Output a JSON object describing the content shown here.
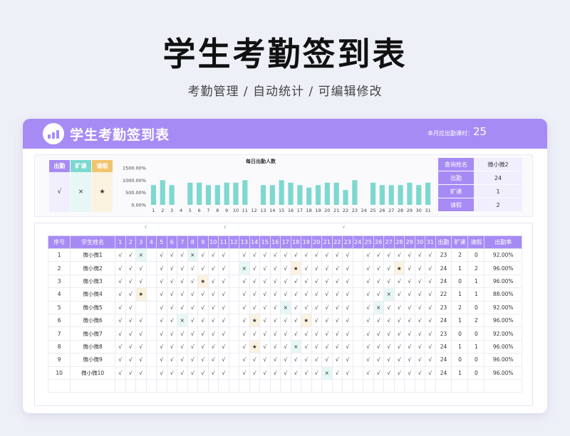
{
  "hero": {
    "title": "学生考勤签到表",
    "subtitle": "考勤管理 / 自动统计 / 可编辑修改"
  },
  "header": {
    "title": "学生考勤签到表",
    "days_label": "本月应出勤课时：",
    "days_value": "25"
  },
  "colors": {
    "accent": "#a78bf5",
    "teal": "#7ed8cf",
    "cream": "#f7d58f",
    "absent_bg": "#e7f7f5",
    "leave_bg": "#fbf2df"
  },
  "legend": [
    {
      "label": "出勤",
      "symbol": "√",
      "head_color": "#a78bf5",
      "body_color": "#f1eefe"
    },
    {
      "label": "旷课",
      "symbol": "×",
      "head_color": "#7ed8cf",
      "body_color": "#e7f7f5"
    },
    {
      "label": "请假",
      "symbol": "★",
      "head_color": "#f2c46d",
      "body_color": "#fbf2df"
    }
  ],
  "query": [
    {
      "label": "查询姓名",
      "value": "微小微2"
    },
    {
      "label": "出勤",
      "value": "24"
    },
    {
      "label": "旷课",
      "value": "1"
    },
    {
      "label": "请假",
      "value": "2"
    }
  ],
  "chart_data": {
    "type": "bar",
    "title": "每日出勤人数",
    "categories": [
      "1",
      "2",
      "3",
      "4",
      "5",
      "6",
      "7",
      "8",
      "9",
      "10",
      "11",
      "12",
      "13",
      "14",
      "15",
      "16",
      "17",
      "18",
      "19",
      "20",
      "21",
      "22",
      "23",
      "24",
      "25",
      "26",
      "27",
      "28",
      "29",
      "30",
      "31"
    ],
    "values": [
      8,
      10,
      8,
      0,
      9,
      9,
      8,
      8,
      9,
      9,
      10,
      0,
      8,
      8,
      10,
      9,
      8,
      7,
      8,
      9,
      9,
      6,
      10,
      0,
      9,
      8,
      8,
      8,
      9,
      8,
      9
    ],
    "yticks": [
      "1500.00%",
      "1000.00%",
      "500.00%",
      "0.00%"
    ],
    "ylim": [
      0,
      15
    ],
    "bar_color": "#7ed8cf"
  },
  "weekend_marks": [
    "√",
    "√",
    "√"
  ],
  "table": {
    "headers": [
      "序号",
      "学生姓名",
      "1",
      "2",
      "3",
      "4",
      "5",
      "6",
      "7",
      "8",
      "9",
      "10",
      "11",
      "12",
      "13",
      "14",
      "15",
      "16",
      "17",
      "18",
      "19",
      "20",
      "21",
      "22",
      "23",
      "24",
      "25",
      "26",
      "27",
      "28",
      "29",
      "30",
      "31",
      "出勤",
      "旷课",
      "请假",
      "出勤率"
    ],
    "rows": [
      {
        "no": "1",
        "name": "微小微1",
        "days": [
          "√",
          "√",
          "×",
          "",
          "√",
          "√",
          "√",
          "×",
          "√",
          "√",
          "√",
          "",
          "√",
          "√",
          "√",
          "√",
          "√",
          "√",
          "√",
          "√",
          "√",
          "√",
          "√",
          "",
          "√",
          "√",
          "√",
          "√",
          "√",
          "√",
          "√"
        ],
        "att": "23",
        "abs": "2",
        "leave": "0",
        "rate": "92.00%"
      },
      {
        "no": "2",
        "name": "微小微2",
        "days": [
          "√",
          "√",
          "√",
          "",
          "√",
          "√",
          "√",
          "√",
          "√",
          "√",
          "√",
          "",
          "×",
          "√",
          "√",
          "√",
          "√",
          "★",
          "√",
          "√",
          "√",
          "√",
          "√",
          "",
          "√",
          "√",
          "√",
          "★",
          "√",
          "√",
          "√"
        ],
        "att": "24",
        "abs": "1",
        "leave": "2",
        "rate": "96.00%"
      },
      {
        "no": "3",
        "name": "微小微3",
        "days": [
          "√",
          "√",
          "√",
          "",
          "√",
          "√",
          "√",
          "√",
          "★",
          "√",
          "√",
          "",
          "√",
          "√",
          "√",
          "√",
          "√",
          "√",
          "√",
          "√",
          "√",
          "√",
          "√",
          "",
          "√",
          "√",
          "√",
          "√",
          "√",
          "√",
          "√"
        ],
        "att": "24",
        "abs": "0",
        "leave": "1",
        "rate": "96.00%"
      },
      {
        "no": "4",
        "name": "微小微4",
        "days": [
          "√",
          "√",
          "★",
          "",
          "√",
          "√",
          "√",
          "√",
          "√",
          "√",
          "√",
          "",
          "√",
          "√",
          "√",
          "√",
          "√",
          "√",
          "√",
          "√",
          "√",
          "√",
          "√",
          "",
          "√",
          "√",
          "×",
          "√",
          "√",
          "√",
          "√"
        ],
        "att": "22",
        "abs": "1",
        "leave": "1",
        "rate": "88.00%"
      },
      {
        "no": "5",
        "name": "微小微5",
        "days": [
          "√",
          "√",
          "",
          "",
          "√",
          "√",
          "√",
          "√",
          "√",
          "√",
          "√",
          "",
          "√",
          "√",
          "√",
          "√",
          "×",
          "√",
          "√",
          "√",
          "√",
          "√",
          "√",
          "",
          "√",
          "×",
          "√",
          "√",
          "√",
          "√",
          "√"
        ],
        "att": "23",
        "abs": "2",
        "leave": "0",
        "rate": "92.00%"
      },
      {
        "no": "6",
        "name": "微小微6",
        "days": [
          "√",
          "√",
          "√",
          "",
          "√",
          "√",
          "×",
          "√",
          "√",
          "√",
          "√",
          "",
          "√",
          "★",
          "√",
          "√",
          "√",
          "√",
          "★",
          "√",
          "√",
          "√",
          "√",
          "",
          "√",
          "√",
          "√",
          "√",
          "√",
          "√",
          "√"
        ],
        "att": "24",
        "abs": "1",
        "leave": "2",
        "rate": "96.00%"
      },
      {
        "no": "7",
        "name": "微小微7",
        "days": [
          "√",
          "√",
          "√",
          "",
          "√",
          "√",
          "√",
          "√",
          "√",
          "√",
          "√",
          "",
          "√",
          "√",
          "√",
          "√",
          "√",
          "√",
          "√",
          "√",
          "√",
          "√",
          "√",
          "",
          "√",
          "√",
          "√",
          "√",
          "√",
          "√",
          "√"
        ],
        "att": "23",
        "abs": "0",
        "leave": "0",
        "rate": "92.00%"
      },
      {
        "no": "8",
        "name": "微小微8",
        "days": [
          "√",
          "√",
          "√",
          "",
          "√",
          "√",
          "√",
          "√",
          "√",
          "√",
          "√",
          "",
          "√",
          "★",
          "√",
          "√",
          "√",
          "×",
          "√",
          "√",
          "√",
          "√",
          "√",
          "",
          "√",
          "√",
          "√",
          "√",
          "√",
          "√",
          "√"
        ],
        "att": "24",
        "abs": "1",
        "leave": "1",
        "rate": "96.00%"
      },
      {
        "no": "9",
        "name": "微小微9",
        "days": [
          "√",
          "√",
          "√",
          "",
          "√",
          "√",
          "√",
          "√",
          "√",
          "√",
          "√",
          "",
          "√",
          "√",
          "√",
          "√",
          "√",
          "√",
          "√",
          "√",
          "√",
          "√",
          "√",
          "",
          "√",
          "√",
          "√",
          "√",
          "√",
          "√",
          "√"
        ],
        "att": "24",
        "abs": "0",
        "leave": "0",
        "rate": "96.00%"
      },
      {
        "no": "10",
        "name": "微小微10",
        "days": [
          "√",
          "√",
          "√",
          "",
          "√",
          "√",
          "√",
          "√",
          "√",
          "√",
          "√",
          "",
          "√",
          "√",
          "√",
          "√",
          "√",
          "√",
          "√",
          "√",
          "×",
          "√",
          "√",
          "",
          "√",
          "√",
          "√",
          "√",
          "√",
          "√",
          "√"
        ],
        "att": "24",
        "abs": "1",
        "leave": "0",
        "rate": "96.00%"
      }
    ]
  }
}
